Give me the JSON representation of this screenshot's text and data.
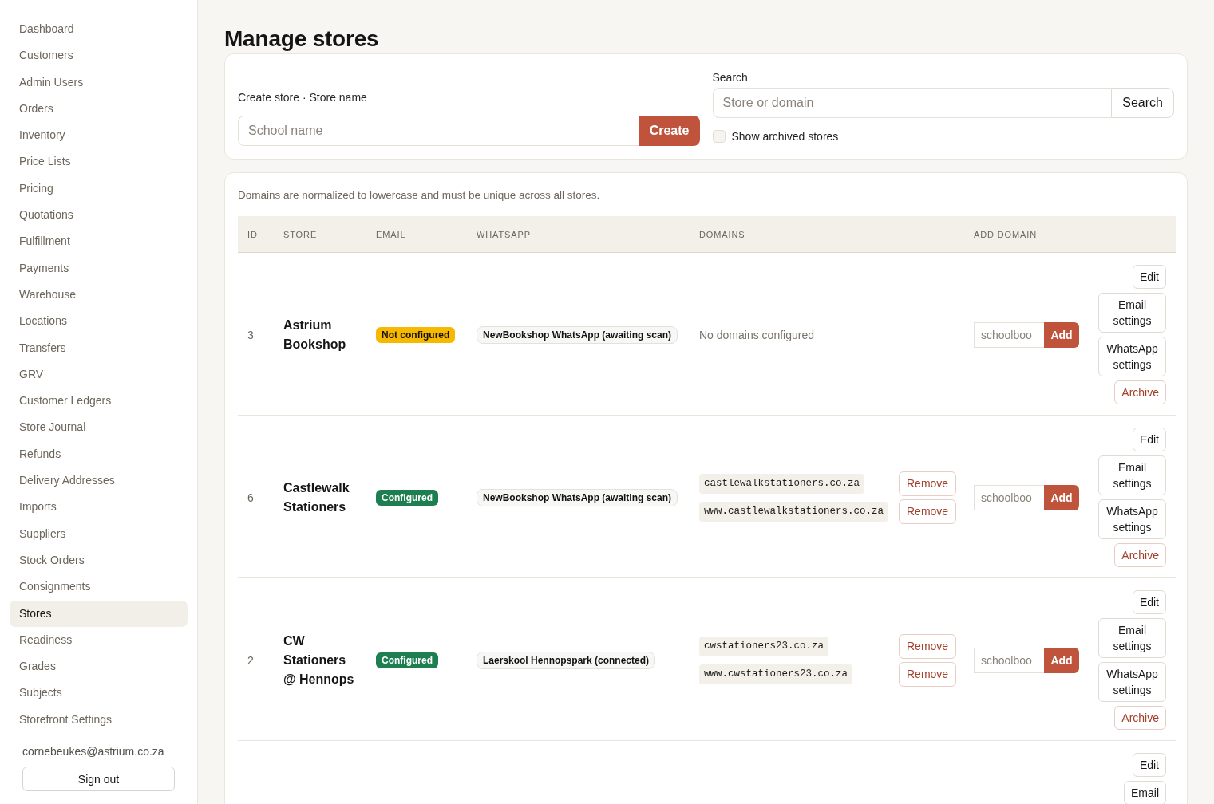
{
  "sidebar": {
    "items": [
      {
        "label": "Dashboard",
        "selected": false
      },
      {
        "label": "Customers",
        "selected": false
      },
      {
        "label": "Admin Users",
        "selected": false
      },
      {
        "label": "Orders",
        "selected": false
      },
      {
        "label": "Inventory",
        "selected": false
      },
      {
        "label": "Price Lists",
        "selected": false
      },
      {
        "label": "Pricing",
        "selected": false
      },
      {
        "label": "Quotations",
        "selected": false
      },
      {
        "label": "Fulfillment",
        "selected": false
      },
      {
        "label": "Payments",
        "selected": false
      },
      {
        "label": "Warehouse",
        "selected": false
      },
      {
        "label": "Locations",
        "selected": false
      },
      {
        "label": "Transfers",
        "selected": false
      },
      {
        "label": "GRV",
        "selected": false
      },
      {
        "label": "Customer Ledgers",
        "selected": false
      },
      {
        "label": "Store Journal",
        "selected": false
      },
      {
        "label": "Refunds",
        "selected": false
      },
      {
        "label": "Delivery Addresses",
        "selected": false
      },
      {
        "label": "Imports",
        "selected": false
      },
      {
        "label": "Suppliers",
        "selected": false
      },
      {
        "label": "Stock Orders",
        "selected": false
      },
      {
        "label": "Consignments",
        "selected": false
      },
      {
        "label": "Stores",
        "selected": true
      },
      {
        "label": "Readiness",
        "selected": false
      },
      {
        "label": "Grades",
        "selected": false
      },
      {
        "label": "Subjects",
        "selected": false
      },
      {
        "label": "Storefront Settings",
        "selected": false
      }
    ],
    "user_email": "cornebeukes@astrium.co.za",
    "sign_out": "Sign out"
  },
  "page": {
    "title": "Manage stores"
  },
  "create_store": {
    "label": "Create store · Store name",
    "placeholder": "School name",
    "button": "Create"
  },
  "search": {
    "label": "Search",
    "placeholder": "Store or domain",
    "button": "Search",
    "show_archived": {
      "label": "Show archived stores",
      "checked": false
    }
  },
  "stores_table": {
    "note": "Domains are normalized to lowercase and must be unique across all stores.",
    "columns": [
      "ID",
      "STORE",
      "EMAIL",
      "WHATSAPP",
      "DOMAINS",
      "ADD DOMAIN"
    ],
    "rows": [
      {
        "id": "3",
        "store": "Astrium Bookshop",
        "email": {
          "label": "Not configured",
          "configured": false
        },
        "whatsapp": "NewBookshop WhatsApp (awaiting scan)",
        "domains": [],
        "no_domains": "No domains configured",
        "add_domain": {
          "placeholder": "schoolboo",
          "button": "Add"
        },
        "actions": [
          {
            "label": "Edit",
            "kind": "edit"
          },
          {
            "label": "Email settings",
            "kind": "email"
          },
          {
            "label": "WhatsApp settings",
            "kind": "whatsapp"
          },
          {
            "label": "Archive",
            "kind": "archive"
          }
        ]
      },
      {
        "id": "6",
        "store": "Castlewalk Stationers",
        "email": {
          "label": "Configured",
          "configured": true
        },
        "whatsapp": "NewBookshop WhatsApp (awaiting scan)",
        "domains": [
          {
            "domain": "castlewalkstationers.co.za",
            "remove": "Remove"
          },
          {
            "domain": "www.castlewalkstationers.co.za",
            "remove": "Remove"
          }
        ],
        "add_domain": {
          "placeholder": "schoolboo",
          "button": "Add"
        },
        "actions": [
          {
            "label": "Edit",
            "kind": "edit"
          },
          {
            "label": "Email settings",
            "kind": "email"
          },
          {
            "label": "WhatsApp settings",
            "kind": "whatsapp"
          },
          {
            "label": "Archive",
            "kind": "archive"
          }
        ]
      },
      {
        "id": "2",
        "store": "CW Stationers @ Hennops",
        "email": {
          "label": "Configured",
          "configured": true
        },
        "whatsapp": "Laerskool Hennopspark (connected)",
        "domains": [
          {
            "domain": "cwstationers23.co.za",
            "remove": "Remove"
          },
          {
            "domain": "www.cwstationers23.co.za",
            "remove": "Remove"
          }
        ],
        "add_domain": {
          "placeholder": "schoolboo",
          "button": "Add"
        },
        "actions": [
          {
            "label": "Edit",
            "kind": "edit"
          },
          {
            "label": "Email settings",
            "kind": "email"
          },
          {
            "label": "WhatsApp settings",
            "kind": "whatsapp"
          },
          {
            "label": "Archive",
            "kind": "archive"
          }
        ]
      },
      {
        "actions": [
          {
            "label": "Edit",
            "kind": "edit"
          },
          {
            "label": "Email",
            "kind": "email"
          }
        ]
      }
    ]
  }
}
